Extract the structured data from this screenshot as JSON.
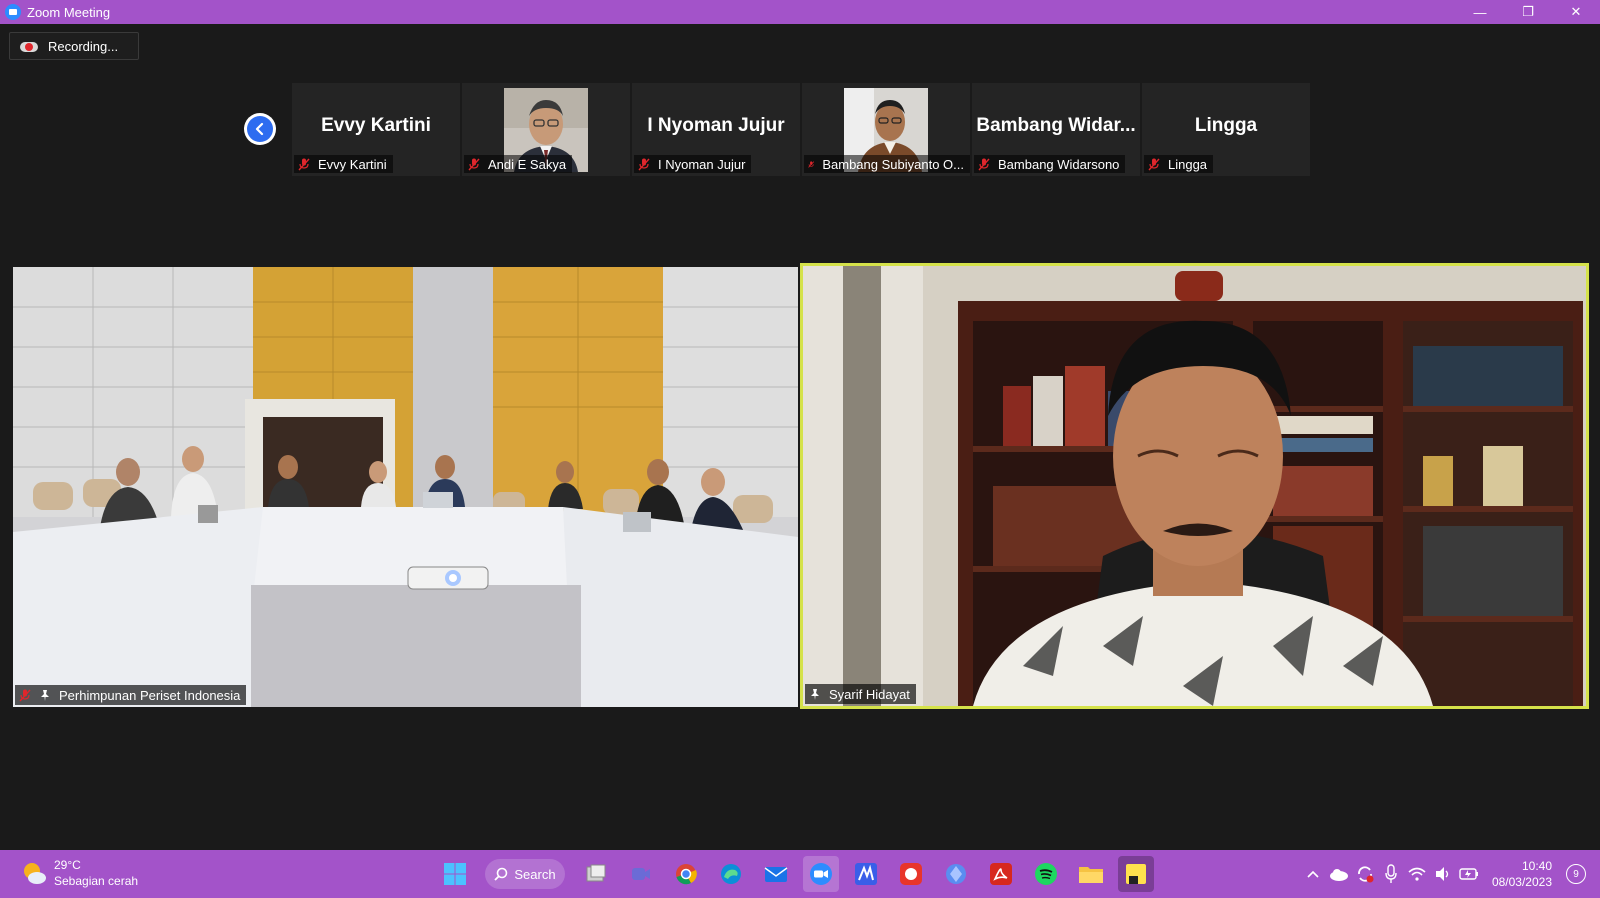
{
  "window": {
    "title": "Zoom Meeting",
    "minimize": "—",
    "restore": "❐",
    "close": "✕"
  },
  "recording": {
    "label": "Recording..."
  },
  "gallery": {
    "tiles": [
      {
        "display_name": "Evvy Kartini",
        "label": "Evvy Kartini",
        "has_photo": false
      },
      {
        "display_name": "",
        "label": "Andi E Sakya",
        "has_photo": true
      },
      {
        "display_name": "I Nyoman Jujur",
        "label": "I Nyoman Jujur",
        "has_photo": false
      },
      {
        "display_name": "",
        "label": "Bambang Subiyanto O...",
        "has_photo": true
      },
      {
        "display_name": "Bambang  Widar...",
        "label": "Bambang Widarsono",
        "has_photo": false
      },
      {
        "display_name": "Lingga",
        "label": "Lingga",
        "has_photo": false
      }
    ]
  },
  "videos": {
    "left": {
      "label": "Perhimpunan Periset Indonesia"
    },
    "right": {
      "label": "Syarif Hidayat"
    }
  },
  "taskbar": {
    "weather_temp": "29°C",
    "weather_desc": "Sebagian cerah",
    "search_label": "Search",
    "time": "10:40",
    "date": "08/03/2023",
    "notifications": "9"
  },
  "colors": {
    "titlebar": "#a353c9",
    "active_speaker_border": "#d5e24a",
    "muted_icon": "#e0262c"
  }
}
